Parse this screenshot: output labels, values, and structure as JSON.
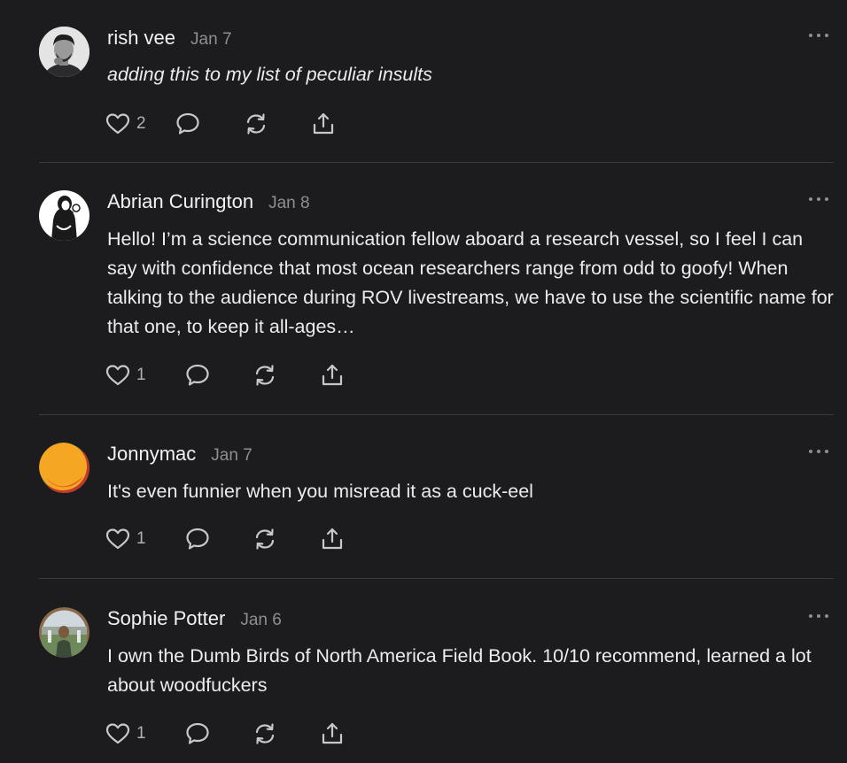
{
  "comments": [
    {
      "author": "rish vee",
      "date": "Jan 7",
      "text": "adding this to my list of peculiar insults",
      "italic": true,
      "likes": "2",
      "avatar_icon": "person-photo-avatar"
    },
    {
      "author": "Abrian Curington",
      "date": "Jan 8",
      "text": "Hello! I’m a science communication fellow aboard a research vessel, so I feel I can say with confidence that most ocean researchers range from odd to goofy! When talking to the audience during ROV livestreams, we have to use the scientific name for that one, to keep it all-ages…",
      "italic": false,
      "likes": "1",
      "avatar_icon": "illustrated-avatar"
    },
    {
      "author": "Jonnymac",
      "date": "Jan 7",
      "text": "It's even funnier when you misread it as a cuck-eel",
      "italic": false,
      "likes": "1",
      "avatar_icon": "abstract-color-avatar"
    },
    {
      "author": "Sophie Potter",
      "date": "Jan 6",
      "text": "I own the Dumb Birds of North America Field Book. 10/10 recommend, learned a lot about woodfuckers",
      "italic": false,
      "likes": "1",
      "avatar_icon": "outdoor-photo-avatar"
    }
  ],
  "icons": {
    "like": "heart-icon",
    "reply": "speech-bubble-icon",
    "restack": "restack-arrows-icon",
    "share": "share-upload-icon",
    "more": "ellipsis-icon"
  },
  "colors": {
    "background": "#1c1c1e",
    "text": "#ececee",
    "muted": "#8e8e93",
    "divider": "#3a3a3c"
  }
}
